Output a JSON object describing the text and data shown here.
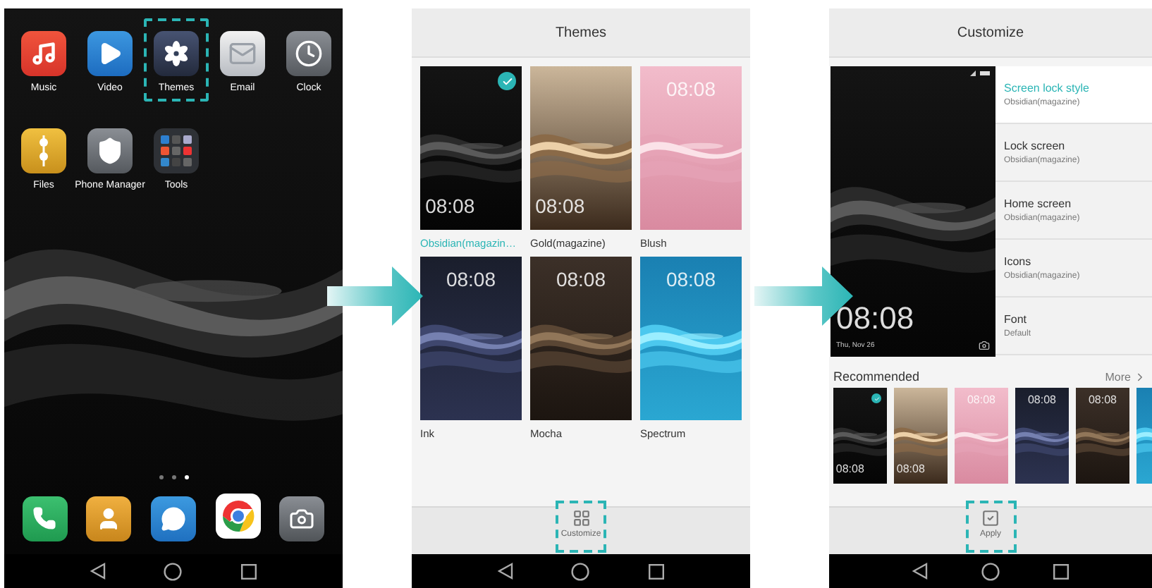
{
  "home_screen": {
    "apps": [
      {
        "label": "Music",
        "kind": "music",
        "highlighted": false
      },
      {
        "label": "Video",
        "kind": "video",
        "highlighted": false
      },
      {
        "label": "Themes",
        "kind": "themes",
        "highlighted": true
      },
      {
        "label": "Email",
        "kind": "email",
        "highlighted": false
      },
      {
        "label": "Clock",
        "kind": "clock",
        "highlighted": false
      },
      {
        "label": "Files",
        "kind": "files",
        "highlighted": false
      },
      {
        "label": "Phone Manager",
        "kind": "phone_manager",
        "highlighted": false
      },
      {
        "label": "Tools",
        "kind": "tools",
        "highlighted": false
      }
    ],
    "page_indicator": [
      {
        "selected": false
      },
      {
        "selected": false
      },
      {
        "selected": true
      }
    ],
    "dock": [
      {
        "kind": "phone"
      },
      {
        "kind": "contacts"
      },
      {
        "kind": "messages"
      },
      {
        "kind": "browser"
      },
      {
        "kind": "camera"
      }
    ]
  },
  "themes_screen": {
    "title": "Themes",
    "themes": [
      {
        "name": "Obsidian(magazin…",
        "kind": "obsidian",
        "clock": "08:08",
        "selected": true
      },
      {
        "name": "Gold(magazine)",
        "kind": "gold",
        "clock": "08:08",
        "selected": false
      },
      {
        "name": "Blush",
        "kind": "blush",
        "clock": "08:08",
        "selected": false
      },
      {
        "name": "Ink",
        "kind": "ink",
        "clock": "08:08",
        "selected": false
      },
      {
        "name": "Mocha",
        "kind": "mocha",
        "clock": "08:08",
        "selected": false
      },
      {
        "name": "Spectrum",
        "kind": "spectrum",
        "clock": "08:08",
        "selected": false
      }
    ],
    "bottom_action": {
      "label": "Customize",
      "highlighted": true
    }
  },
  "customize_screen": {
    "title": "Customize",
    "preview": {
      "clock": "08:08",
      "date": "Thu, Nov 26"
    },
    "options": [
      {
        "label": "Screen lock style",
        "value": "Obsidian(magazine)",
        "selected": true
      },
      {
        "label": "Lock screen",
        "value": "Obsidian(magazine)",
        "selected": false
      },
      {
        "label": "Home screen",
        "value": "Obsidian(magazine)",
        "selected": false
      },
      {
        "label": "Icons",
        "value": "Obsidian(magazine)",
        "selected": false
      },
      {
        "label": "Font",
        "value": "Default",
        "selected": false
      }
    ],
    "recommended": {
      "title": "Recommended",
      "more": "More",
      "items": [
        {
          "kind": "obsidian",
          "clock": "08:08",
          "selected": true
        },
        {
          "kind": "gold",
          "clock": "08:08",
          "selected": false
        },
        {
          "kind": "blush",
          "clock": "08:08",
          "selected": false
        },
        {
          "kind": "ink",
          "clock": "08:08",
          "selected": false
        },
        {
          "kind": "mocha",
          "clock": "08:08",
          "selected": false
        },
        {
          "kind": "spectrum"
        }
      ]
    },
    "bottom_action": {
      "label": "Apply",
      "highlighted": true
    }
  }
}
